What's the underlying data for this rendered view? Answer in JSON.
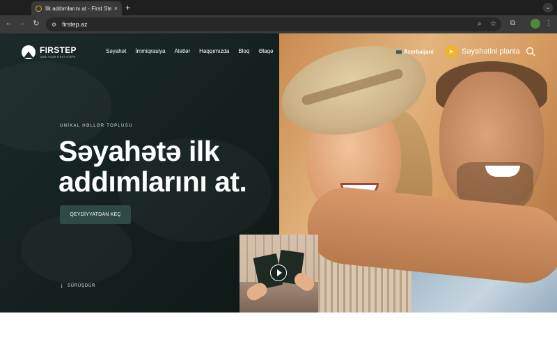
{
  "browser": {
    "tab_title": "İlk addımlarını at - First Step",
    "tab_close": "×",
    "new_tab": "+",
    "url": "firstep.az"
  },
  "site": {
    "logo_name": "FIRSTEP",
    "logo_tagline": "TAKE YOUR FIRST STEPS",
    "nav": [
      "Səyahət",
      "İmmiqrasiya",
      "Alətlər",
      "Haqqımızda",
      "Bloq",
      "Əlaqə"
    ],
    "language": "Azerbaijani",
    "plan_trip": "Səyahətini planla"
  },
  "hero": {
    "eyebrow": "UNİKAL HƏLLƏR TOPLUSU",
    "headline": "Səyahətə ilk addımlarını at.",
    "cta": "QEYDİYYATDAN KEÇ",
    "scroll": "SÜRÜŞDÜR"
  },
  "colors": {
    "hero_dark": "#1a2b2a",
    "cta_bg": "#2e4a47",
    "plan_accent": "#f0b429"
  }
}
